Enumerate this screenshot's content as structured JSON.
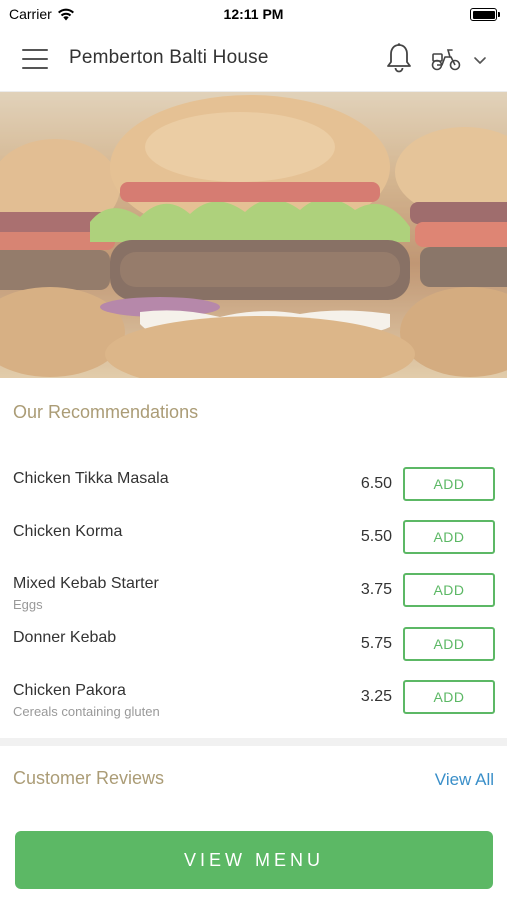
{
  "status_bar": {
    "carrier": "Carrier",
    "time": "12:11 PM"
  },
  "header": {
    "title": "Pemberton Balti House"
  },
  "recommendations": {
    "title": "Our Recommendations",
    "items": [
      {
        "name": "Chicken Tikka Masala",
        "sub": "",
        "price": "6.50",
        "button": "ADD"
      },
      {
        "name": "Chicken Korma",
        "sub": "",
        "price": "5.50",
        "button": "ADD"
      },
      {
        "name": "Mixed Kebab Starter",
        "sub": "Eggs",
        "price": "3.75",
        "button": "ADD"
      },
      {
        "name": "Donner Kebab",
        "sub": "",
        "price": "5.75",
        "button": "ADD"
      },
      {
        "name": "Chicken Pakora",
        "sub": "Cereals containing gluten",
        "price": "3.25",
        "button": "ADD"
      }
    ]
  },
  "reviews": {
    "title": "Customer Reviews",
    "view_all": "View All"
  },
  "cta": {
    "label": "VIEW MENU"
  },
  "colors": {
    "accent_green": "#5cb865",
    "section_title": "#ab9c76",
    "link_blue": "#3a8fc9"
  },
  "icons": {
    "menu": "hamburger-menu-icon",
    "notifications": "bell-icon",
    "delivery": "scooter-icon",
    "dropdown": "chevron-down-icon",
    "wifi": "wifi-icon",
    "battery": "battery-icon"
  }
}
